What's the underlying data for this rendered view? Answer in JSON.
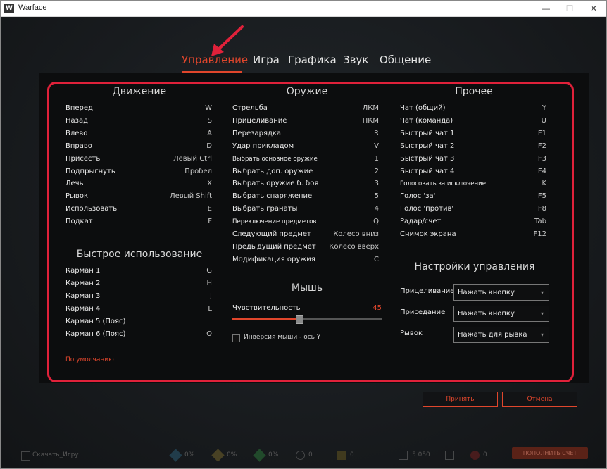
{
  "window": {
    "title": "Warface",
    "icon_text": "W",
    "minimize": "—",
    "maximize": "☐",
    "close": "✕"
  },
  "tabs": [
    "Управление",
    "Игра",
    "Графика",
    "Звук",
    "Общение"
  ],
  "movement": {
    "title": "Движение",
    "rows": [
      {
        "label": "Вперед",
        "key": "W"
      },
      {
        "label": "Назад",
        "key": "S"
      },
      {
        "label": "Влево",
        "key": "A"
      },
      {
        "label": "Вправо",
        "key": "D"
      },
      {
        "label": "Присесть",
        "key": "Левый Ctrl"
      },
      {
        "label": "Подпрыгнуть",
        "key": "Пробел"
      },
      {
        "label": "Лечь",
        "key": "X"
      },
      {
        "label": "Рывок",
        "key": "Левый Shift"
      },
      {
        "label": "Использовать",
        "key": "E"
      },
      {
        "label": "Подкат",
        "key": "F"
      }
    ]
  },
  "quick_use": {
    "title": "Быстрое использование",
    "rows": [
      {
        "label": "Карман 1",
        "key": "G"
      },
      {
        "label": "Карман 2",
        "key": "H"
      },
      {
        "label": "Карман 3",
        "key": "J"
      },
      {
        "label": "Карман 4",
        "key": "L"
      },
      {
        "label": "Карман 5 (Пояс)",
        "key": "I"
      },
      {
        "label": "Карман 6 (Пояс)",
        "key": "O"
      }
    ]
  },
  "default_link": "По умолчанию",
  "weapon": {
    "title": "Оружие",
    "rows": [
      {
        "label": "Стрельба",
        "key": "ЛКМ"
      },
      {
        "label": "Прицеливание",
        "key": "ПКМ"
      },
      {
        "label": "Перезарядка",
        "key": "R"
      },
      {
        "label": "Удар прикладом",
        "key": "V"
      },
      {
        "label": "Выбрать основное оружие",
        "key": "1"
      },
      {
        "label": "Выбрать доп. оружие",
        "key": "2"
      },
      {
        "label": "Выбрать оружие б. боя",
        "key": "3"
      },
      {
        "label": "Выбрать снаряжение",
        "key": "5"
      },
      {
        "label": "Выбрать гранаты",
        "key": "4"
      },
      {
        "label": "Переключение предметов",
        "key": "Q"
      },
      {
        "label": "Следующий предмет",
        "key": "Колесо вниз"
      },
      {
        "label": "Предыдущий предмет",
        "key": "Колесо вверх"
      },
      {
        "label": "Модификация оружия",
        "key": "C"
      }
    ]
  },
  "mouse": {
    "title": "Мышь",
    "sensitivity_label": "Чувствительность",
    "sensitivity_value": "45",
    "sensitivity_fraction": 0.45,
    "invert_label": "Инверсия мыши - ось Y",
    "invert_checked": false
  },
  "other": {
    "title": "Прочее",
    "rows": [
      {
        "label": "Чат (общий)",
        "key": "Y"
      },
      {
        "label": "Чат (команда)",
        "key": "U"
      },
      {
        "label": "Быстрый чат 1",
        "key": "F1"
      },
      {
        "label": "Быстрый чат 2",
        "key": "F2"
      },
      {
        "label": "Быстрый чат 3",
        "key": "F3"
      },
      {
        "label": "Быстрый чат 4",
        "key": "F4"
      },
      {
        "label": "Голосовать за исключение",
        "key": "K"
      },
      {
        "label": "Голос 'за'",
        "key": "F5"
      },
      {
        "label": "Голос 'против'",
        "key": "F8"
      },
      {
        "label": "Радар/счет",
        "key": "Tab"
      },
      {
        "label": "Снимок экрана",
        "key": "F12"
      }
    ]
  },
  "control_settings": {
    "title": "Настройки управления",
    "items": [
      {
        "label": "Прицеливание",
        "value": "Нажать кнопку"
      },
      {
        "label": "Приседание",
        "value": "Нажать кнопку"
      },
      {
        "label": "Рывок",
        "value": "Нажать для рывка"
      }
    ],
    "caret": "▾"
  },
  "buttons": {
    "apply": "Принять",
    "cancel": "Отмена"
  },
  "bottom_bar": {
    "download": "Скачать_Игру",
    "stats": [
      "0%",
      "0%",
      "0%",
      "0",
      "0"
    ],
    "currency": "5 050",
    "kredits": "0",
    "refill": "ПОПОЛНИТЬ СЧЕТ"
  },
  "colors": {
    "accent": "#e0462c",
    "outline": "#e0213a",
    "panel": "#0c0d0e"
  }
}
